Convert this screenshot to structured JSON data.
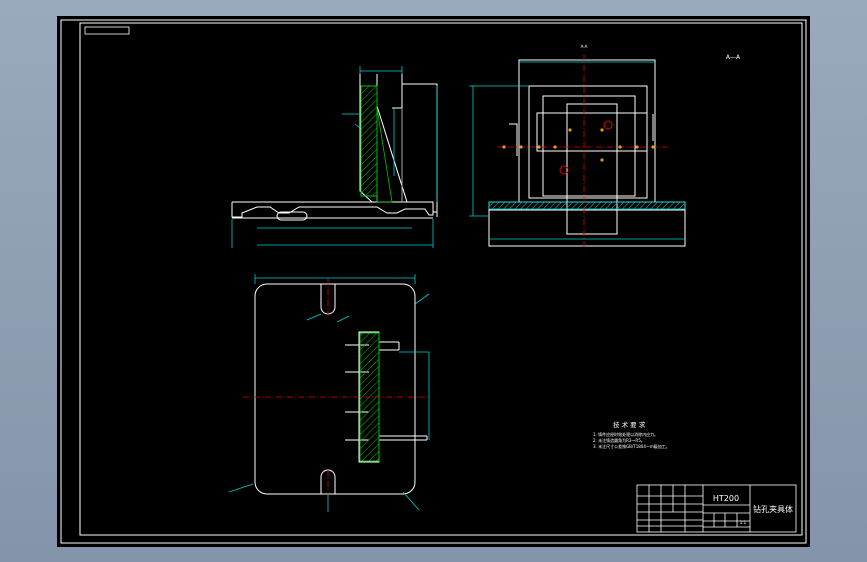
{
  "drawing": {
    "title_block": {
      "material": "HT200",
      "part_name": "钻孔夹具体",
      "scale_value": "1:1"
    },
    "technical_requirements": {
      "heading": "技 术 要 求",
      "items": [
        "1. 铸件应经时效处理以消除内应力。",
        "2. 未注铸造圆角为R3～R5。",
        "3. 未注尺寸公差按GB/T1804—m级加工。"
      ]
    },
    "view_label": "A—A",
    "top_label": "A-A"
  }
}
